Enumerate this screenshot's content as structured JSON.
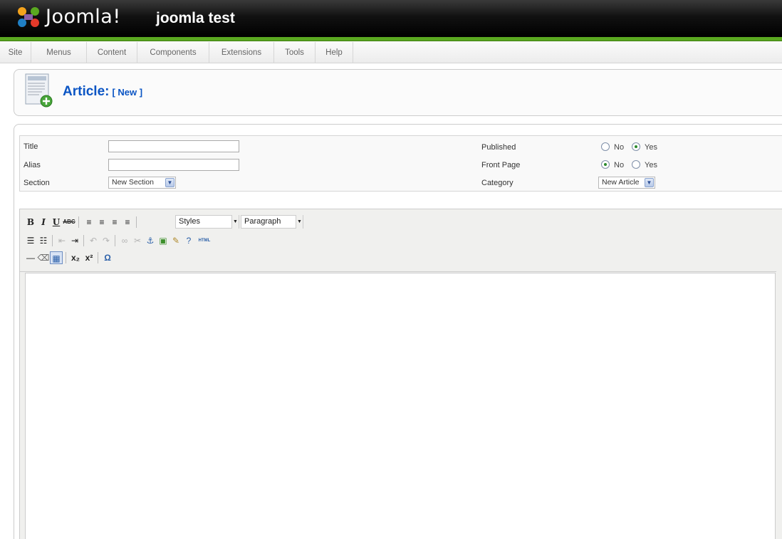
{
  "header": {
    "logo_text": "Joomla!",
    "site_name": "joomla test"
  },
  "menu": [
    "Site",
    "Menus",
    "Content",
    "Components",
    "Extensions",
    "Tools",
    "Help"
  ],
  "page": {
    "title": "Article:",
    "subtitle": "[ New ]"
  },
  "form": {
    "title_label": "Title",
    "alias_label": "Alias",
    "section_label": "Section",
    "section_value": "New Section",
    "published_label": "Published",
    "frontpage_label": "Front Page",
    "category_label": "Category",
    "category_value": "New Article",
    "no_label": "No",
    "yes_label": "Yes",
    "published_value": "Yes",
    "frontpage_value": "No"
  },
  "editor": {
    "styles_label": "Styles",
    "format_label": "Paragraph",
    "html_label": "HTML"
  },
  "colors": {
    "accent_green": "#5aa820",
    "title_blue": "#0b55c4"
  }
}
